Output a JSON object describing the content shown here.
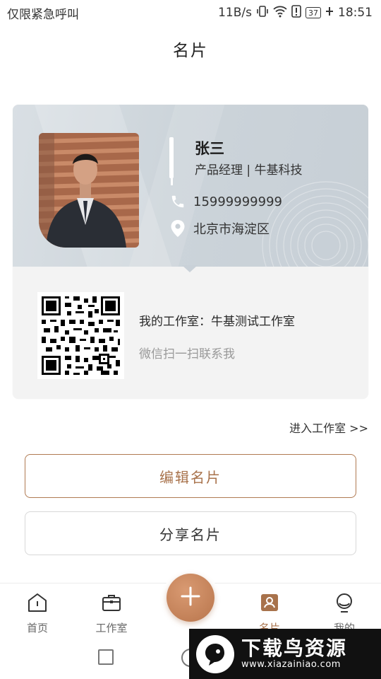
{
  "status_bar": {
    "carrier": "仅限紧急呼叫",
    "speed": "11B/s",
    "battery": "37",
    "time": "18:51"
  },
  "page_title": "名片",
  "card": {
    "name": "张三",
    "position": "产品经理 | 牛基科技",
    "phone": "15999999999",
    "address": "北京市海淀区",
    "studio": "我的工作室：牛基测试工作室",
    "scan_hint": "微信扫一扫联系我"
  },
  "enter_studio": "进入工作室 >>",
  "buttons": {
    "edit": "编辑名片",
    "share": "分享名片"
  },
  "tab_bar": {
    "home": "首页",
    "studio": "工作室",
    "card": "名片",
    "mine": "我的"
  },
  "colors": {
    "accent": "#a8724b",
    "fab": "#c7845a"
  },
  "watermark": {
    "title": "下载鸟资源",
    "url": "www.xiazainiao.com"
  }
}
